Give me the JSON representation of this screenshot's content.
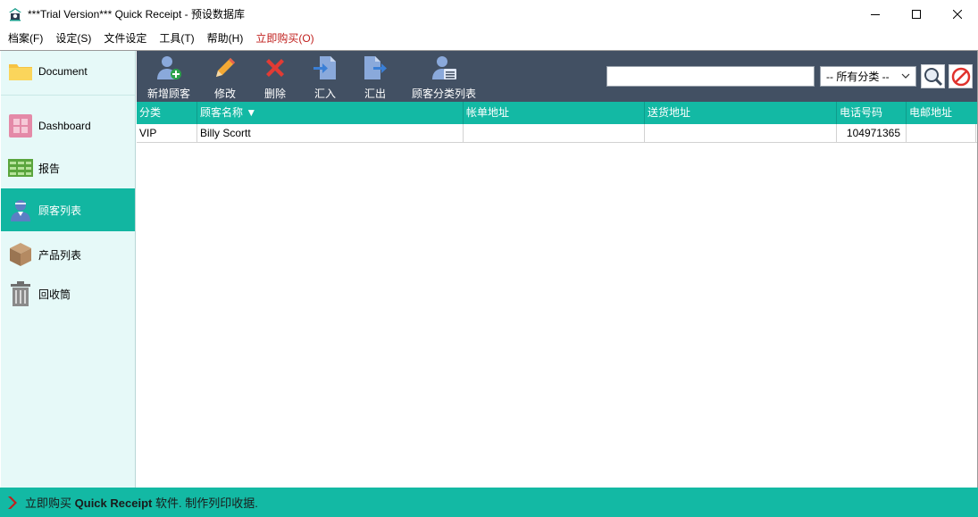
{
  "window": {
    "title": "***Trial Version*** Quick Receipt - 预设数据库"
  },
  "menu": {
    "items": [
      "档案(F)",
      "设定(S)",
      "文件设定",
      "工具(T)",
      "帮助(H)"
    ],
    "buy": "立即购买(O)"
  },
  "sidebar": {
    "items": [
      {
        "label": "Document",
        "icon": "folder-icon"
      },
      {
        "label": "Dashboard",
        "icon": "dashboard-icon"
      },
      {
        "label": "报告",
        "icon": "report-icon"
      },
      {
        "label": "顾客列表",
        "icon": "customer-icon",
        "active": true
      },
      {
        "label": "产品列表",
        "icon": "product-box-icon"
      },
      {
        "label": "回收筒",
        "icon": "trash-icon"
      }
    ]
  },
  "toolbar": {
    "buttons": [
      {
        "label": "新增顾客",
        "icon": "add-customer-icon"
      },
      {
        "label": "修改",
        "icon": "pencil-icon"
      },
      {
        "label": "删除",
        "icon": "delete-x-icon"
      },
      {
        "label": "汇入",
        "icon": "import-icon"
      },
      {
        "label": "汇出",
        "icon": "export-icon"
      },
      {
        "label": "顾客分类列表",
        "icon": "customer-category-icon"
      }
    ],
    "search_value": "",
    "category_select": "-- 所有分类 --"
  },
  "grid": {
    "columns": [
      "分类",
      "顾客名称 ▼",
      "帐单地址",
      "送货地址",
      "电话号码",
      "电邮地址"
    ],
    "rows": [
      [
        "VIP",
        "Billy Scortt",
        "",
        "",
        "104971365",
        ""
      ]
    ]
  },
  "status": {
    "prefix": "立即购买",
    "product": "Quick Receipt",
    "suffix": "软件. 制作列印收据."
  },
  "colors": {
    "accent": "#13b9a4",
    "toolbar": "#425063",
    "sidebar": "#e6f9f8",
    "buy_menu": "#c0201e"
  }
}
